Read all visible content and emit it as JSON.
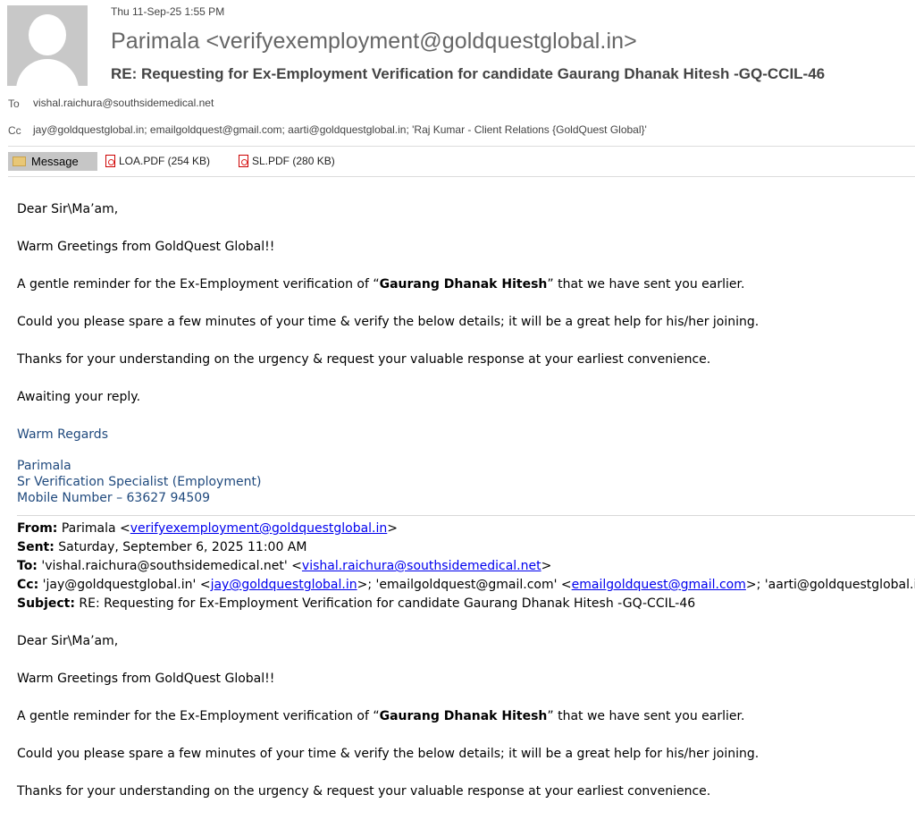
{
  "header": {
    "date": "Thu 11-Sep-25 1:55 PM",
    "sender": "Parimala <verifyexemployment@goldquestglobal.in>",
    "subject": "RE: Requesting for Ex-Employment Verification for candidate  Gaurang Dhanak Hitesh -GQ-CCIL-46",
    "to_label": "To",
    "to_value": "vishal.raichura@southsidemedical.net",
    "cc_label": "Cc",
    "cc_value": "jay@goldquestglobal.in; emailgoldquest@gmail.com; aarti@goldquestglobal.in; 'Raj Kumar - Client Relations {GoldQuest Global}'"
  },
  "attachments": {
    "message_tab": "Message",
    "items": [
      {
        "label": "LOA.PDF (254 KB)"
      },
      {
        "label": "SL.PDF (280 KB)"
      }
    ]
  },
  "body": {
    "greeting": "Dear Sir\\Ma’am,",
    "warm": "Warm Greetings from GoldQuest Global!!",
    "reminder_pre": "A gentle reminder for the Ex-Employment verification of “",
    "candidate": "Gaurang Dhanak Hitesh",
    "reminder_post": "” that we have sent you earlier.",
    "spare": "Could you please spare a few minutes of your time & verify the below details; it will be a great help for his/her joining.",
    "thanks": "Thanks for your understanding on the urgency & request your valuable response at your earliest convenience.",
    "awaiting": "Awaiting your reply.",
    "regards": "Warm Regards",
    "sig_name": "Parimala",
    "sig_title": "Sr Verification Specialist (Employment)",
    "sig_mobile": "Mobile Number – 63627 94509"
  },
  "quoted": {
    "from_label": "From:",
    "from_name": " Parimala <",
    "from_email": "verifyexemployment@goldquestglobal.in",
    "from_close": ">",
    "sent_label": "Sent:",
    "sent_value": " Saturday, September 6, 2025 11:00 AM",
    "to_label": "To:",
    "to_name": " 'vishal.raichura@southsidemedical.net' <",
    "to_email": "vishal.raichura@southsidemedical.net",
    "to_close": ">",
    "cc_label": "Cc:",
    "cc_p1": " 'jay@goldquestglobal.in' <",
    "cc_e1": "jay@goldquestglobal.in",
    "cc_p2": ">; 'emailgoldquest@gmail.com' <",
    "cc_e2": "emailgoldquest@gmail.com",
    "cc_p3": ">; 'aarti@goldquestglobal.in' <",
    "subject_label": "Subject:",
    "subject_value": " RE: Requesting for Ex-Employment Verification for candidate Gaurang Dhanak Hitesh -GQ-CCIL-46",
    "greeting": "Dear Sir\\Ma’am,",
    "warm": "Warm Greetings from GoldQuest Global!!",
    "reminder_pre": "A gentle reminder for the Ex-Employment verification of “",
    "candidate": "Gaurang Dhanak Hitesh",
    "reminder_post": "” that we have sent you earlier.",
    "spare": "Could you please spare a few minutes of your time & verify the below details; it will be a great  help for his/her joining.",
    "thanks": "Thanks for your understanding on the urgency & request your valuable response at your earliest convenience."
  }
}
